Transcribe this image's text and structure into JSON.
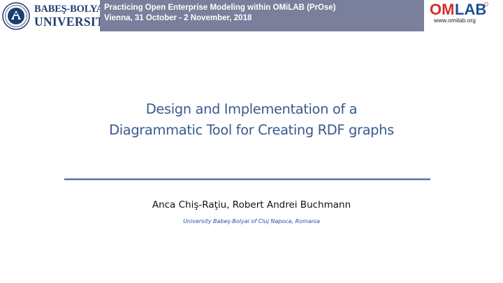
{
  "header": {
    "university": {
      "line1": "BABEŞ-BOLYAI",
      "line2": "UNIVERSITY"
    },
    "event": "Practicing Open Enterprise Modeling within OMiLAB (PrOse)",
    "location_date": "Vienna, 31 October - 2 November, 2018",
    "omlab": {
      "logo_text": "OMLAB",
      "url": "www.omilab.org"
    }
  },
  "slide": {
    "title_line1": "Design and Implementation of a",
    "title_line2": "Diagrammatic Tool for Creating RDF graphs",
    "authors": "Anca Chiş-Raţiu, Robert Andrei Buchmann",
    "affiliation": "University Babeş-Bolyai of Cluj Napoca, Romania"
  },
  "colors": {
    "banner": "#7a7f9b",
    "title": "#3b5a8f",
    "rule": "#4f6fa8",
    "omlab_red": "#d32f2f",
    "omlab_blue": "#1f4f9a",
    "ubb_navy": "#1f3c6e"
  }
}
